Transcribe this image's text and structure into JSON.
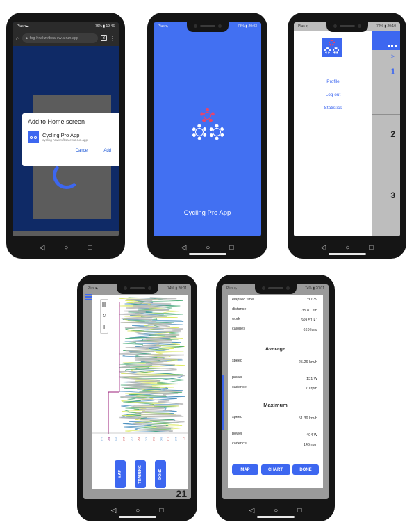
{
  "colors": {
    "blue": "#3d67f0",
    "pink": "#e8456b",
    "dark_overlay": "#0f2a66"
  },
  "phone1": {
    "status": {
      "left": "Plus ▾▴ᵢₗ",
      "right": "76% ▮ 19:46"
    },
    "url": "fog-hrwkzvfbsa-ew.a.run.app",
    "tab_count": "3",
    "dialog": {
      "title": "Add to Home screen",
      "app_name": "Cycling Pro App",
      "app_url": "cycling-hrwkzvfbsa-ew.a.run.app",
      "cancel": "Cancel",
      "add": "Add"
    }
  },
  "phone2": {
    "status": {
      "left": "Plus ▾ᵢₗ",
      "right": "73% ▮ 20:03"
    },
    "app_title": "Cycling Pro App"
  },
  "phone3": {
    "status": {
      "left": "Plus ▾ᵢₗ",
      "right": "72% ▮ 20:10"
    },
    "menu": [
      "Profile",
      "Log out",
      "Statistics"
    ],
    "numbers": [
      "1",
      "2",
      "3"
    ],
    "chevron": ">"
  },
  "phone4": {
    "status": {
      "left": "Plus ▾ᵢₗ",
      "right": "74% ▮ 20:01"
    },
    "tools": {
      "bars": "|||",
      "refresh": "↻",
      "move": "✛"
    },
    "buttons": [
      "MAP",
      "TRAINING",
      "DONE"
    ],
    "axis_labels": [
      "148",
      "480",
      "101",
      "150",
      "170",
      "350",
      "320",
      "250",
      "200",
      "271",
      "165",
      "17"
    ],
    "row_number": "21"
  },
  "phone5": {
    "status": {
      "left": "Plus ▾ᵢₗ",
      "right": "74% ▮ 20:01"
    },
    "summary": [
      {
        "label": "elapsed time",
        "value": "1:30:39"
      },
      {
        "label": "distance",
        "value": "35.81 km"
      },
      {
        "label": "work",
        "value": "669.51 kJ"
      },
      {
        "label": "calories",
        "value": "669 kcal"
      }
    ],
    "average_title": "Average",
    "average": [
      {
        "label": "speed",
        "value": "25.26 km/h"
      },
      {
        "label": "power",
        "value": "131  W"
      },
      {
        "label": "cadence",
        "value": "70 rpm"
      }
    ],
    "maximum_title": "Maximum",
    "maximum": [
      {
        "label": "speed",
        "value": "51.39 km/h"
      },
      {
        "label": "power",
        "value": "404  W"
      },
      {
        "label": "cadence",
        "value": "146 rpm"
      }
    ],
    "buttons": [
      "MAP",
      "CHART",
      "DONE"
    ]
  },
  "nav_icons": [
    "◁",
    "○",
    "□"
  ]
}
